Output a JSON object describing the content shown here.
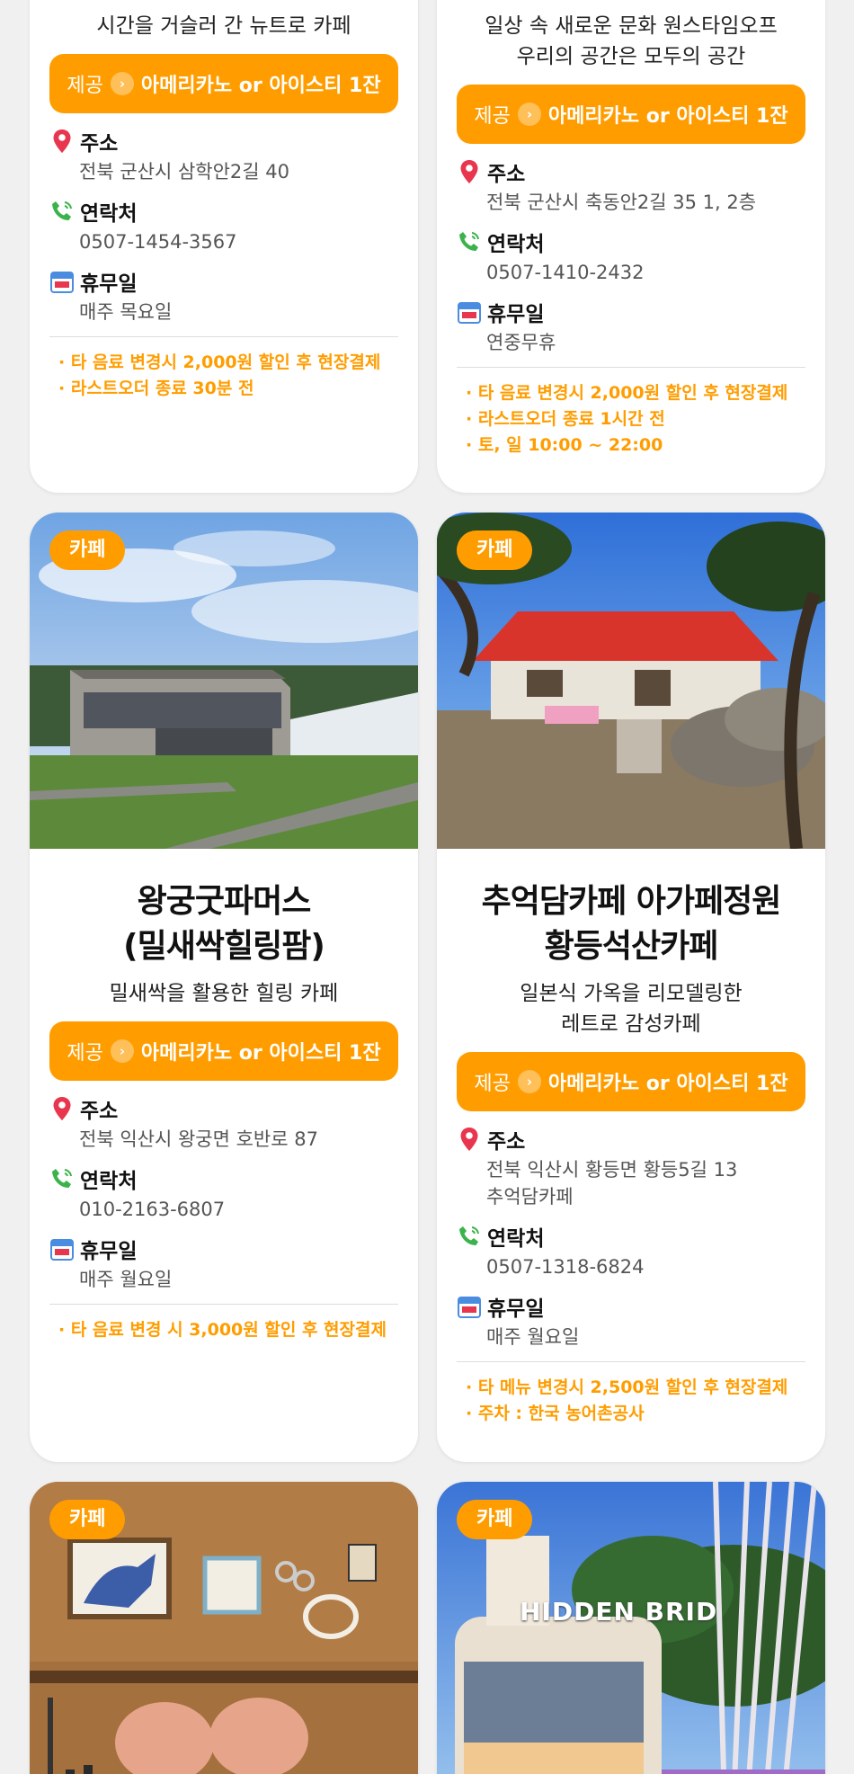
{
  "badge_label": "카페",
  "offer_prefix": "제공",
  "labels": {
    "address": "주소",
    "phone": "연락처",
    "holiday": "휴무일"
  },
  "cards": [
    {
      "subtitle": "시간을 거슬러 간 뉴트로 카페",
      "offer": "아메리카노 or 아이스티 1잔",
      "address": "전북 군산시 삼학안2길 40",
      "phone": "0507-1454-3567",
      "holiday": "매주 목요일",
      "notes": [
        "· 타 음료 변경시 2,000원 할인 후 현장결제",
        "· 라스트오더 종료 30분 전"
      ]
    },
    {
      "subtitle_line1": "일상 속 새로운 문화 원스타임오프",
      "subtitle_line2": "우리의 공간은 모두의 공간",
      "offer": "아메리카노 or 아이스티 1잔",
      "address": "전북 군산시 축동안2길 35 1, 2층",
      "phone": "0507-1410-2432",
      "holiday": "연중무휴",
      "notes": [
        "· 타 음료 변경시 2,000원 할인 후 현장결제",
        "· 라스트오더 종료 1시간 전",
        "· 토, 일 10:00 ~ 22:00"
      ]
    },
    {
      "title_line1": "왕궁굿파머스",
      "title_line2": "(밀새싹힐링팜)",
      "subtitle": "밀새싹을 활용한 힐링 카페",
      "offer": "아메리카노 or 아이스티 1잔",
      "address": "전북 익산시 왕궁면 호반로 87",
      "phone": "010-2163-6807",
      "holiday": "매주 월요일",
      "notes": [
        "· 타 음료 변경 시 3,000원 할인 후 현장결제"
      ]
    },
    {
      "title_line1": "추억담카페 아가페정원",
      "title_line2": "황등석산카페",
      "subtitle_line1": "일본식 가옥을 리모델링한",
      "subtitle_line2": "레트로 감성카페",
      "offer": "아메리카노 or 아이스티 1잔",
      "address_line1": "전북 익산시 황등면 황등5길 13",
      "address_line2": "추억담카페",
      "phone": "0507-1318-6824",
      "holiday": "매주 월요일",
      "notes": [
        "· 타 메뉴 변경시 2,500원 할인 후 현장결제",
        "· 주차 : 한국 농어촌공사"
      ]
    },
    {
      "image_sign": "HIDDEN BRID"
    }
  ],
  "colors": {
    "accent": "#ff9d00",
    "pin": "#e8364f",
    "phone": "#3bb34a"
  }
}
